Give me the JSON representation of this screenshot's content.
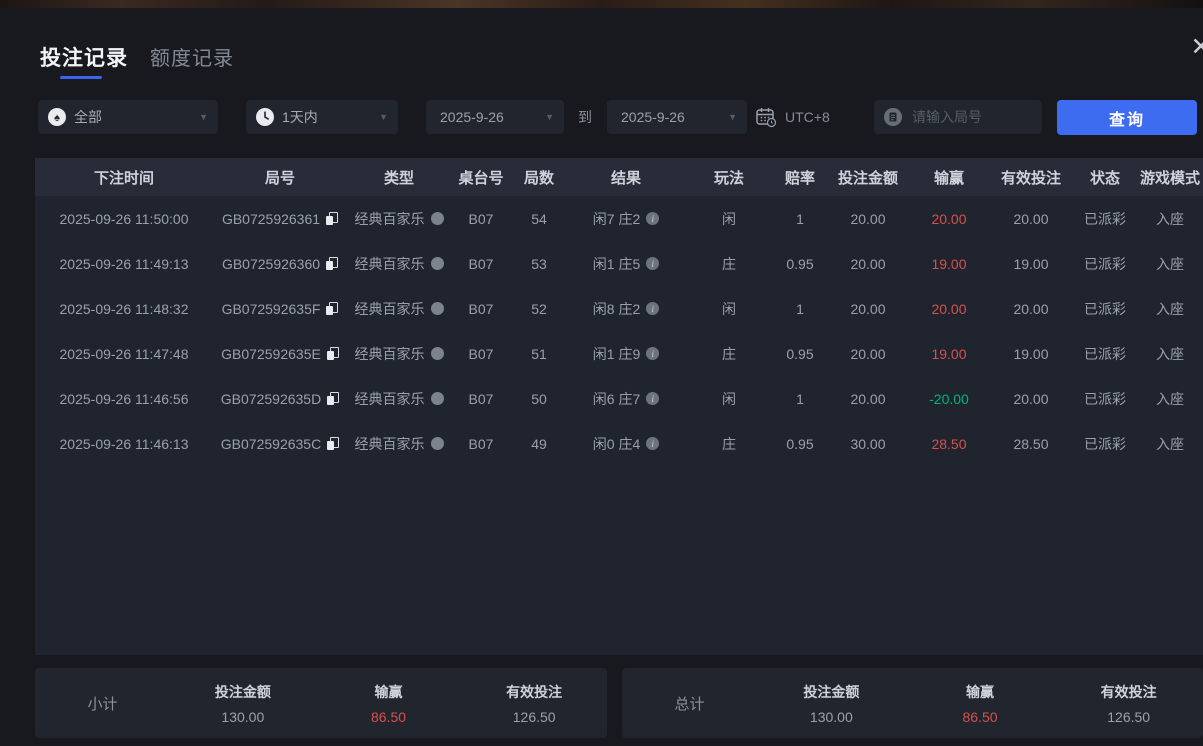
{
  "colors": {
    "accent_blue": "#3d6cf0",
    "win_red": "#d9504c",
    "win_green": "#00b578"
  },
  "close_glyph": "✕",
  "tabs": [
    {
      "label": "投注记录"
    },
    {
      "label": "额度记录"
    }
  ],
  "filters": {
    "game_type": "全部",
    "time_range": "1天内",
    "date_from": "2025-9-26",
    "to_label": "到",
    "date_to": "2025-9-26",
    "timezone": "UTC+8",
    "round_placeholder": "请输入局号",
    "search_label": "查询"
  },
  "table": {
    "columns": [
      "下注时间",
      "局号",
      "类型",
      "桌台号",
      "局数",
      "结果",
      "玩法",
      "赔率",
      "投注金额",
      "输赢",
      "有效投注",
      "状态",
      "游戏模式"
    ],
    "rows": [
      {
        "time": "2025-09-26 11:50:00",
        "round_id": "GB0725926361",
        "type": "经典百家乐",
        "table_no": "B07",
        "round_no": "54",
        "result": "闲7 庄2",
        "play": "闲",
        "odds": "1",
        "bet": "20.00",
        "win": "20.00",
        "win_style": "red",
        "valid": "20.00",
        "status": "已派彩",
        "mode": "入座"
      },
      {
        "time": "2025-09-26 11:49:13",
        "round_id": "GB0725926360",
        "type": "经典百家乐",
        "table_no": "B07",
        "round_no": "53",
        "result": "闲1 庄5",
        "play": "庄",
        "odds": "0.95",
        "bet": "20.00",
        "win": "19.00",
        "win_style": "red",
        "valid": "19.00",
        "status": "已派彩",
        "mode": "入座"
      },
      {
        "time": "2025-09-26 11:48:32",
        "round_id": "GB072592635F",
        "type": "经典百家乐",
        "table_no": "B07",
        "round_no": "52",
        "result": "闲8 庄2",
        "play": "闲",
        "odds": "1",
        "bet": "20.00",
        "win": "20.00",
        "win_style": "red",
        "valid": "20.00",
        "status": "已派彩",
        "mode": "入座"
      },
      {
        "time": "2025-09-26 11:47:48",
        "round_id": "GB072592635E",
        "type": "经典百家乐",
        "table_no": "B07",
        "round_no": "51",
        "result": "闲1 庄9",
        "play": "庄",
        "odds": "0.95",
        "bet": "20.00",
        "win": "19.00",
        "win_style": "red",
        "valid": "19.00",
        "status": "已派彩",
        "mode": "入座"
      },
      {
        "time": "2025-09-26 11:46:56",
        "round_id": "GB072592635D",
        "type": "经典百家乐",
        "table_no": "B07",
        "round_no": "50",
        "result": "闲6 庄7",
        "play": "闲",
        "odds": "1",
        "bet": "20.00",
        "win": "-20.00",
        "win_style": "green",
        "valid": "20.00",
        "status": "已派彩",
        "mode": "入座"
      },
      {
        "time": "2025-09-26 11:46:13",
        "round_id": "GB072592635C",
        "type": "经典百家乐",
        "table_no": "B07",
        "round_no": "49",
        "result": "闲0 庄4",
        "play": "庄",
        "odds": "0.95",
        "bet": "30.00",
        "win": "28.50",
        "win_style": "red",
        "valid": "28.50",
        "status": "已派彩",
        "mode": "入座"
      }
    ]
  },
  "summary": {
    "subtotal": {
      "label": "小计",
      "bet_label": "投注金额",
      "bet_value": "130.00",
      "win_label": "输赢",
      "win_value": "86.50",
      "valid_label": "有效投注",
      "valid_value": "126.50"
    },
    "total": {
      "label": "总计",
      "bet_label": "投注金额",
      "bet_value": "130.00",
      "win_label": "输赢",
      "win_value": "86.50",
      "valid_label": "有效投注",
      "valid_value": "126.50"
    }
  }
}
